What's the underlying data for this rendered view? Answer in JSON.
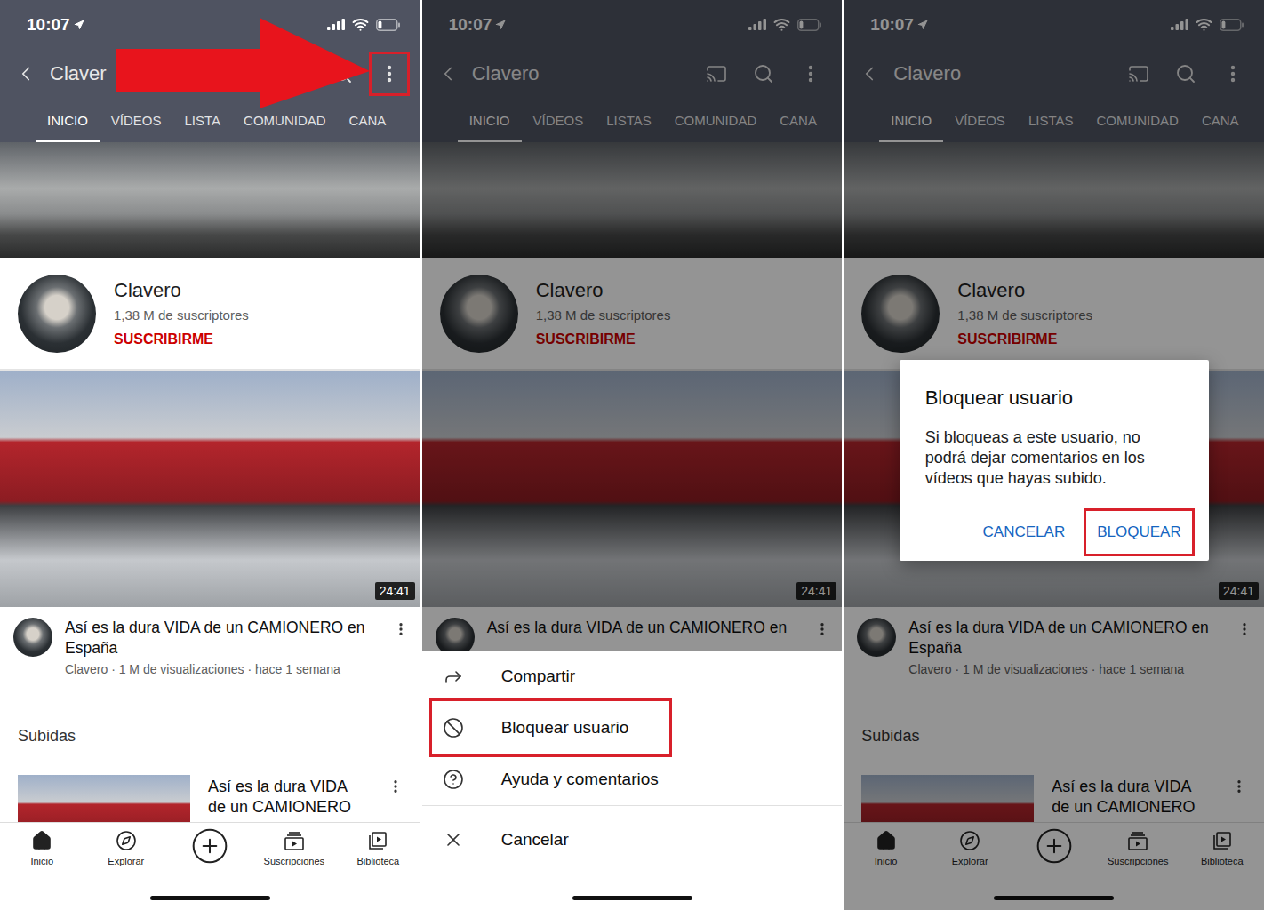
{
  "panels": [
    {
      "dimmed": false,
      "annotation_arrow": true,
      "status_bar": {
        "time": "10:07",
        "battery_level": 0.2
      },
      "header": {
        "title": "Claver",
        "more_highlighted": true
      },
      "tabs": [
        {
          "label": "INICIO",
          "selected": true
        },
        {
          "label": "VÍDEOS",
          "selected": false
        },
        {
          "label": "LISTA",
          "selected": false
        },
        {
          "label": "COMUNIDAD",
          "selected": false
        },
        {
          "label": "CANA",
          "selected": false
        }
      ],
      "channel": {
        "name": "Clavero",
        "subscribers": "1,38 M de suscriptores",
        "subscribe": "SUSCRIBIRME"
      },
      "featured_video": {
        "duration": "24:41",
        "title": "Así es la dura VIDA de un CAMIONERO en España",
        "meta": "Clavero · 1 M de visualizaciones · hace 1 semana"
      },
      "uploads": {
        "heading": "Subidas",
        "title": "Así es la dura VIDA de un CAMIONERO"
      },
      "bottom_nav": [
        {
          "kind": "home",
          "label": "Inicio",
          "selected": true
        },
        {
          "kind": "explore",
          "label": "Explorar",
          "selected": false
        },
        {
          "kind": "create",
          "selected": false
        },
        {
          "kind": "subscriptions",
          "label": "Suscripciones",
          "selected": false
        },
        {
          "kind": "library",
          "label": "Biblioteca",
          "selected": false
        }
      ]
    },
    {
      "dimmed": true,
      "annotation_arrow": false,
      "status_bar": {
        "time": "10:07",
        "battery_level": 0.2
      },
      "header": {
        "title": "Clavero",
        "more_highlighted": false
      },
      "tabs": [
        {
          "label": "INICIO",
          "selected": true
        },
        {
          "label": "VÍDEOS",
          "selected": false
        },
        {
          "label": "LISTAS",
          "selected": false
        },
        {
          "label": "COMUNIDAD",
          "selected": false
        },
        {
          "label": "CANA",
          "selected": false
        }
      ],
      "channel": {
        "name": "Clavero",
        "subscribers": "1,38 M de suscriptores",
        "subscribe": "SUSCRIBIRME"
      },
      "featured_video": {
        "duration": "24:41",
        "title": "Así es la dura VIDA de un CAMIONERO en"
      },
      "bottom_sheet": [
        {
          "kind": "share",
          "label": "Compartir",
          "highlighted": false
        },
        {
          "kind": "block",
          "label": "Bloquear usuario",
          "highlighted": true
        },
        {
          "kind": "help",
          "label": "Ayuda y comentarios",
          "highlighted": false
        },
        {
          "kind": "cancel",
          "label": "Cancelar",
          "highlighted": false
        }
      ]
    },
    {
      "dimmed": true,
      "annotation_arrow": false,
      "status_bar": {
        "time": "10:07",
        "battery_level": 0.2
      },
      "header": {
        "title": "Clavero",
        "more_highlighted": false
      },
      "tabs": [
        {
          "label": "INICIO",
          "selected": true
        },
        {
          "label": "VÍDEOS",
          "selected": false
        },
        {
          "label": "LISTAS",
          "selected": false
        },
        {
          "label": "COMUNIDAD",
          "selected": false
        },
        {
          "label": "CANA",
          "selected": false
        }
      ],
      "channel": {
        "name": "Clavero",
        "subscribers": "1,38 M de suscriptores",
        "subscribe": "SUSCRIBIRME"
      },
      "featured_video": {
        "duration": "24:41",
        "title": "Así es la dura VIDA de un CAMIONERO en España",
        "meta": "Clavero · 1 M de visualizaciones · hace 1 semana"
      },
      "uploads": {
        "heading": "Subidas",
        "title": "Así es la dura VIDA de un CAMIONERO"
      },
      "bottom_nav": [
        {
          "kind": "home",
          "label": "Inicio",
          "selected": true
        },
        {
          "kind": "explore",
          "label": "Explorar",
          "selected": false
        },
        {
          "kind": "create",
          "selected": false
        },
        {
          "kind": "subscriptions",
          "label": "Suscripciones",
          "selected": false
        },
        {
          "kind": "library",
          "label": "Biblioteca",
          "selected": false
        }
      ],
      "dialog": {
        "title": "Bloquear usuario",
        "body": "Si bloqueas a este usuario, no podrá dejar comentarios en los vídeos que hayas subido.",
        "buttons": [
          {
            "label": "CANCELAR",
            "highlighted": false
          },
          {
            "label": "BLOQUEAR",
            "highlighted": true
          }
        ]
      }
    }
  ]
}
